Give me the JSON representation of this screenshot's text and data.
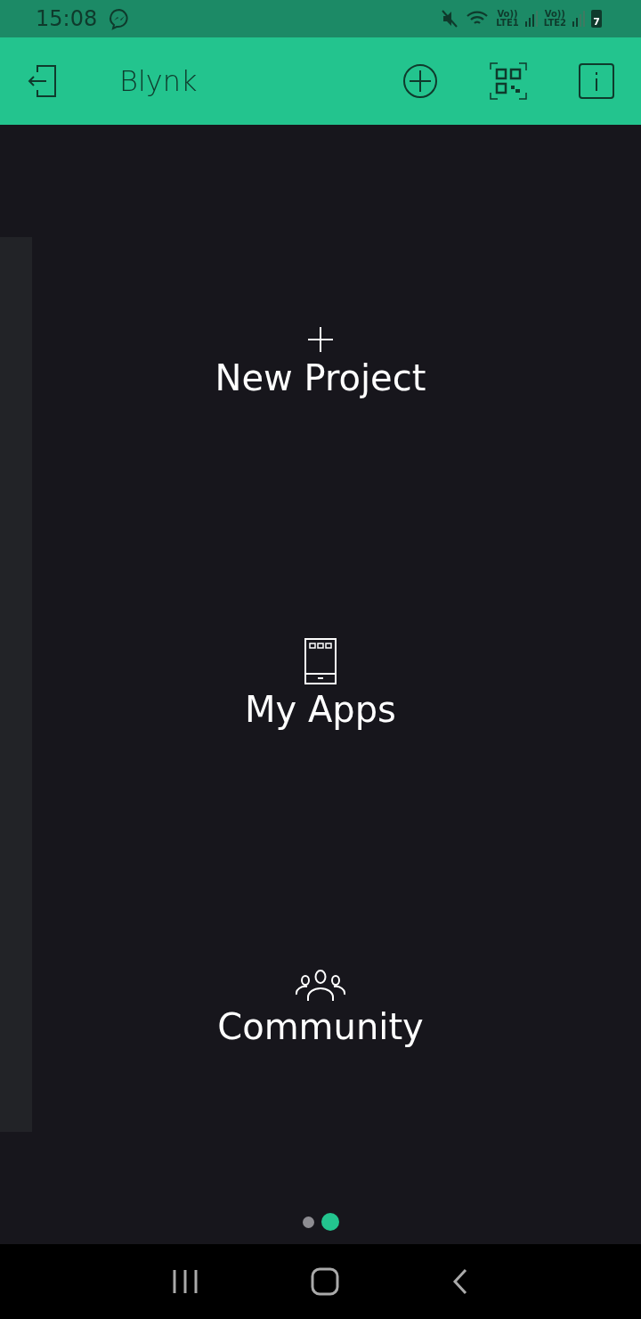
{
  "status_bar": {
    "time": "15:08",
    "sim1": {
      "top": "Vo))",
      "bottom": "LTE1"
    },
    "sim2": {
      "top": "Vo))",
      "bottom": "LTE2"
    },
    "battery": "7"
  },
  "app_bar": {
    "title": "Blynk"
  },
  "actions": [
    {
      "kind": "plus",
      "label": "New Project"
    },
    {
      "kind": "phone",
      "label": "My Apps"
    },
    {
      "kind": "people",
      "label": "Community"
    }
  ],
  "pages": [
    {
      "selected": false
    },
    {
      "selected": true
    }
  ]
}
